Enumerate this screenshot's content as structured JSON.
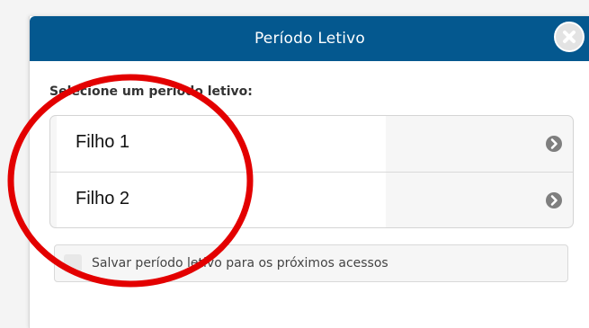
{
  "dialog": {
    "title": "Período Letivo",
    "close_icon": "close-circle-icon",
    "prompt": "Selecione um período letivo:",
    "options": [
      {
        "label": "Filho 1",
        "icon": "chevron-right-icon"
      },
      {
        "label": "Filho 2",
        "icon": "chevron-right-icon"
      }
    ],
    "save_preference": {
      "label": "Salvar período letivo para os próximos acessos",
      "checked": false
    }
  },
  "colors": {
    "header": "#04588f",
    "annotation_circle": "#e30000"
  }
}
